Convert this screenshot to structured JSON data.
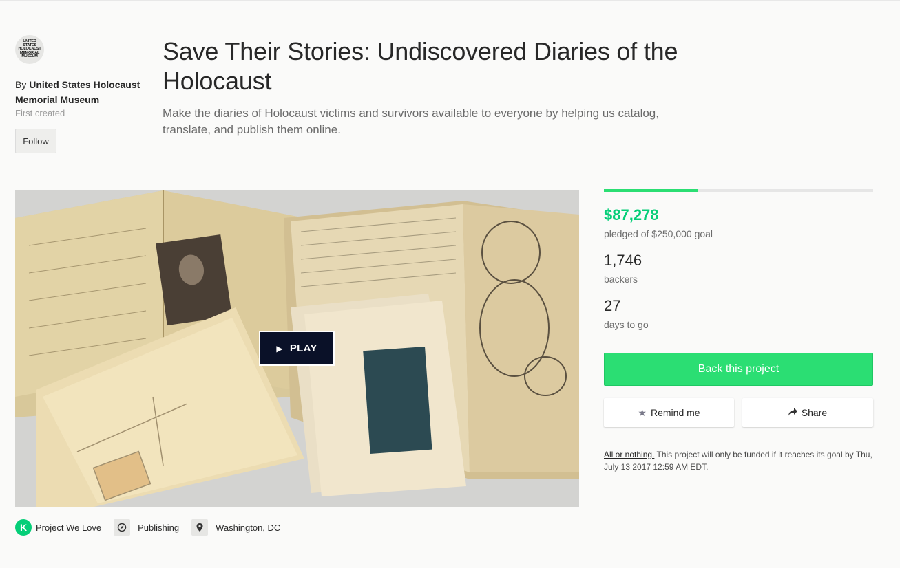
{
  "creator": {
    "logo_text": "UNITED STATES HOLOCAUST MEMORIAL MUSEUM",
    "by_prefix": "By",
    "name": "United States Holocaust Memorial Museum",
    "first_created": "First created",
    "follow_label": "Follow"
  },
  "project": {
    "title": "Save Their Stories: Undiscovered Diaries of the Holocaust",
    "blurb": "Make the diaries of Holocaust victims and survivors available to everyone by helping us catalog, translate, and publish them online."
  },
  "video": {
    "play_label": "PLAY",
    "play_icon": "play-icon"
  },
  "tags": [
    {
      "label": "Project We Love",
      "icon": "kickstarter-k-icon",
      "icon_text": "K"
    },
    {
      "label": "Publishing",
      "icon": "compass-icon"
    },
    {
      "label": "Washington, DC",
      "icon": "location-pin-icon"
    }
  ],
  "stats": {
    "pledged": "$87,278",
    "pledged_label": "pledged of $250,000 goal",
    "backers": "1,746",
    "backers_label": "backers",
    "days": "27",
    "days_label": "days to go",
    "progress_fraction": 0.349
  },
  "actions": {
    "back_label": "Back this project",
    "remind_label": "Remind me",
    "share_label": "Share"
  },
  "funding_note": {
    "link": "All or nothing.",
    "text": " This project will only be funded if it reaches its goal by Thu, July 13 2017 12:59 AM EDT."
  },
  "colors": {
    "accent_green": "#2bde73",
    "pledged_green": "#05ce78",
    "play_bg": "#0a1128"
  }
}
